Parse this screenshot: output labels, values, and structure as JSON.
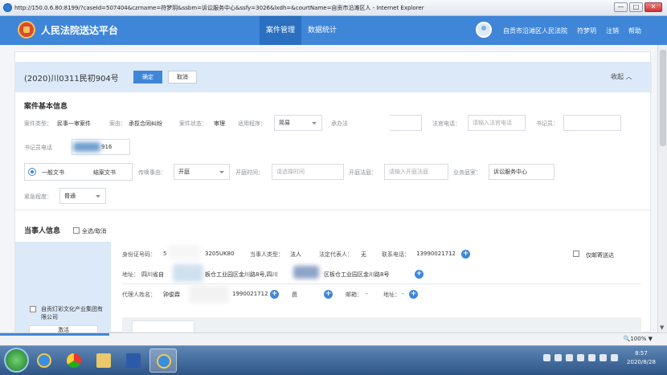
{
  "window": {
    "title": "http://150.0.6.80:8199/?caseId=507404&czrname=符梦玥&ssbm=诉讼服务中心&ssfy=3026&lxdh=&courtName=自贡市沿滩区人 - Internet Explorer",
    "minimize": "—",
    "maximize": "□",
    "close": "✕"
  },
  "app": {
    "title": "人民法院送达平台",
    "nav": [
      "案件管理",
      "数据统计"
    ],
    "court": "自贡市沿滩区人民法院",
    "user": "符梦玥",
    "logout": "注销",
    "help": "帮助"
  },
  "case": {
    "number": "(2020)川0311民初904号",
    "confirm": "确定",
    "cancel": "取消",
    "collapse": "收起",
    "collapse_glyph": "︿"
  },
  "basic": {
    "section_title": "案件基本信息",
    "case_type_label": "案件类型：",
    "case_type": "民事一审案件",
    "cause_label": "案由：",
    "cause": "承揽合同纠纷",
    "status_label": "案件状态：",
    "status": "审理",
    "procedure_label": "适用程序：",
    "procedure": "简易",
    "judge_label": "承办法",
    "judge_phone_label": "法官电话：",
    "judge_phone_placeholder": "请输入法官电话",
    "clerk_label": "书记员：",
    "clerk_phone_label": "书记员电话",
    "clerk_phone_tail": "916",
    "doc_general": "一般文书",
    "doc_closing": "结案文书",
    "reason_label": "传唤事由：",
    "reason": "开庭",
    "hearing_time_label": "开庭时间：",
    "hearing_time_placeholder": "请选择时间",
    "court_room_label": "开庭法庭：",
    "court_room_placeholder": "请输入开庭法庭",
    "service_room_label": "业务庭室：",
    "service_room": "诉讼服务中心",
    "urgency_label": "紧急程度：",
    "urgency": "普通"
  },
  "parties": {
    "section_title": "当事人信息",
    "select_all": "全选/取消",
    "party_name": "自贡灯彩文化产业集团有限公司",
    "party_btn": "激活",
    "id_label": "身份证号码：",
    "id_head": "5",
    "id_tail": "3205UK80",
    "party_type_label": "当事人类型：",
    "party_type": "法人",
    "legal_rep_label": "法定代表人：",
    "legal_rep": "无",
    "phone_label": "联系电话：",
    "phone": "13990021712",
    "mail_only": "仅邮寄送达",
    "address_label": "地址：",
    "address_a": "四川省自",
    "address_b": "板仓工业园区金川路8号,四川",
    "address_c": "区板仓工业园区金川路8号",
    "agent_label": "代理人姓名：",
    "agent_name": "钟俊霖",
    "agent_phone": "1990021712",
    "agent_extra": "邑",
    "email_label": "邮箱：",
    "email": "-",
    "addr2_label": "地址：",
    "addr2": "-"
  },
  "status_bar": {
    "zoom": "🔍100%",
    "zoom_caret": "▼"
  },
  "taskbar": {
    "time": "8:57",
    "date": "2020/8/28"
  },
  "colors": {
    "primary": "#3f86d9",
    "header_bg": "#dce9f8"
  }
}
